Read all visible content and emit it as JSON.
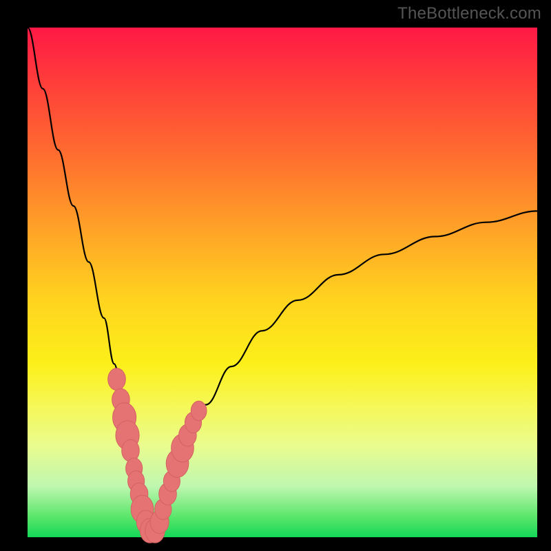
{
  "watermark": "TheBottleneck.com",
  "chart_data": {
    "type": "line",
    "title": "",
    "xlabel": "",
    "ylabel": "",
    "xlim": [
      0,
      100
    ],
    "ylim": [
      0,
      100
    ],
    "grid": false,
    "background": "gradient-red-yellow-green-vertical",
    "description": "V-shaped bottleneck curve on a vertical red→yellow→green gradient. Black line descends steeply from upper-left, reaches minimum (~0) near x≈24, then rises concavely to ~64 at right edge. Pink bead-like markers cluster on both arms near the valley.",
    "series": [
      {
        "name": "bottleneck-curve",
        "x": [
          0,
          3,
          6,
          9,
          12,
          15,
          17,
          19,
          20.5,
          22,
          23,
          24,
          25,
          26,
          28,
          31,
          35,
          40,
          46,
          53,
          61,
          70,
          80,
          90,
          100
        ],
        "y": [
          100,
          88,
          76,
          65,
          54,
          43,
          34,
          25,
          17,
          9,
          4,
          0.5,
          1,
          4,
          10,
          18,
          26,
          33.5,
          40.5,
          46.5,
          51.5,
          55.5,
          59,
          61.8,
          64
        ]
      }
    ],
    "markers": {
      "name": "pink-beads",
      "color": "#e57373",
      "points": [
        {
          "x": 17.5,
          "y": 31,
          "r": 3.6
        },
        {
          "x": 18.3,
          "y": 27,
          "r": 3.6
        },
        {
          "x": 19.0,
          "y": 23.5,
          "r": 4.8
        },
        {
          "x": 19.6,
          "y": 20.0,
          "r": 4.8
        },
        {
          "x": 20.2,
          "y": 17.0,
          "r": 3.6
        },
        {
          "x": 20.9,
          "y": 13.5,
          "r": 3.4
        },
        {
          "x": 21.3,
          "y": 11.0,
          "r": 3.4
        },
        {
          "x": 21.9,
          "y": 8.5,
          "r": 3.6
        },
        {
          "x": 22.5,
          "y": 5.5,
          "r": 4.6
        },
        {
          "x": 23.2,
          "y": 3.0,
          "r": 3.8
        },
        {
          "x": 24.0,
          "y": 1.3,
          "r": 4.0
        },
        {
          "x": 25.0,
          "y": 1.3,
          "r": 4.0
        },
        {
          "x": 25.9,
          "y": 3.0,
          "r": 3.8
        },
        {
          "x": 26.6,
          "y": 5.5,
          "r": 3.4
        },
        {
          "x": 27.5,
          "y": 8.5,
          "r": 3.6
        },
        {
          "x": 28.3,
          "y": 11.0,
          "r": 3.4
        },
        {
          "x": 29.4,
          "y": 14.5,
          "r": 4.6
        },
        {
          "x": 30.4,
          "y": 17.5,
          "r": 4.6
        },
        {
          "x": 31.4,
          "y": 20.0,
          "r": 3.6
        },
        {
          "x": 32.5,
          "y": 22.5,
          "r": 3.4
        },
        {
          "x": 33.6,
          "y": 24.8,
          "r": 3.2
        }
      ]
    }
  }
}
